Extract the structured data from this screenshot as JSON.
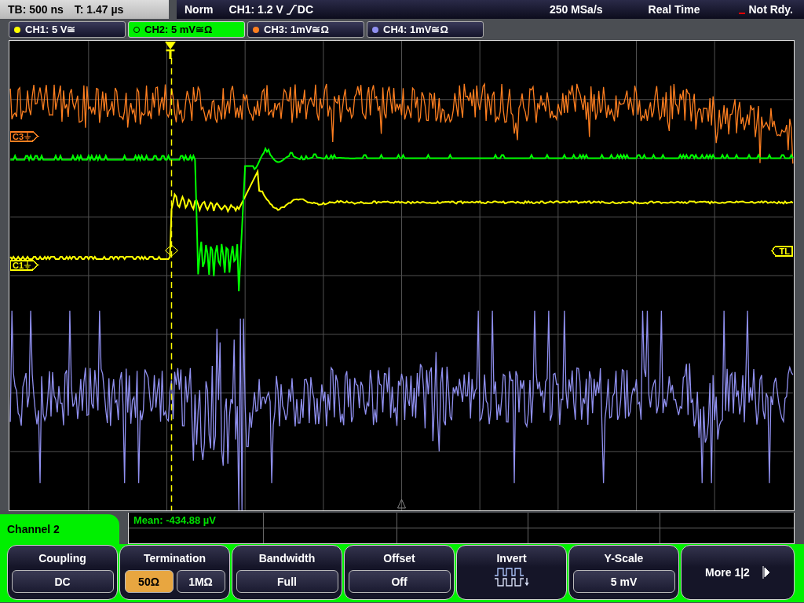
{
  "top_bar": {
    "timebase": "TB: 500 ns",
    "trigger_time": "T: 1.47 µs",
    "mode": "Norm",
    "trigger_source": "CH1: 1.2 V",
    "trigger_coupling": "DC",
    "sample_rate": "250 MSa/s",
    "acquisition": "Real Time",
    "status": "Not Rdy."
  },
  "channel_tabs": [
    {
      "label": "CH1: 5 V≅",
      "color": "#ffff00",
      "selected": false
    },
    {
      "label": "CH2: 5 mV≅Ω",
      "color": "#00ff00",
      "selected": true
    },
    {
      "label": "CH3: 1mV≅Ω",
      "color": "#ff7f20",
      "selected": false
    },
    {
      "label": "CH4: 1mV≅Ω",
      "color": "#9090f0",
      "selected": false
    }
  ],
  "trigger_marker": {
    "label": "T"
  },
  "markers": [
    {
      "kind": "channel",
      "label": "C3",
      "color": "#ff7f20"
    },
    {
      "kind": "channel",
      "label": "C1",
      "color": "#ffff00"
    },
    {
      "kind": "level",
      "label": "TL",
      "color": "#ffff00"
    }
  ],
  "measurement": {
    "label": "Mean: -434.88 µV"
  },
  "menu": {
    "title": "Channel 2",
    "softkeys": [
      {
        "kind": "value",
        "title": "Coupling",
        "value": "DC"
      },
      {
        "kind": "options",
        "title": "Termination",
        "options": [
          {
            "label": "50Ω",
            "selected": true
          },
          {
            "label": "1MΩ",
            "selected": false
          }
        ]
      },
      {
        "kind": "value",
        "title": "Bandwidth",
        "value": "Full"
      },
      {
        "kind": "value",
        "title": "Offset",
        "value": "Off"
      },
      {
        "kind": "icon",
        "title": "Invert"
      },
      {
        "kind": "value",
        "title": "Y-Scale",
        "value": "5 mV"
      },
      {
        "kind": "more",
        "title": "More 1|2"
      }
    ]
  }
}
